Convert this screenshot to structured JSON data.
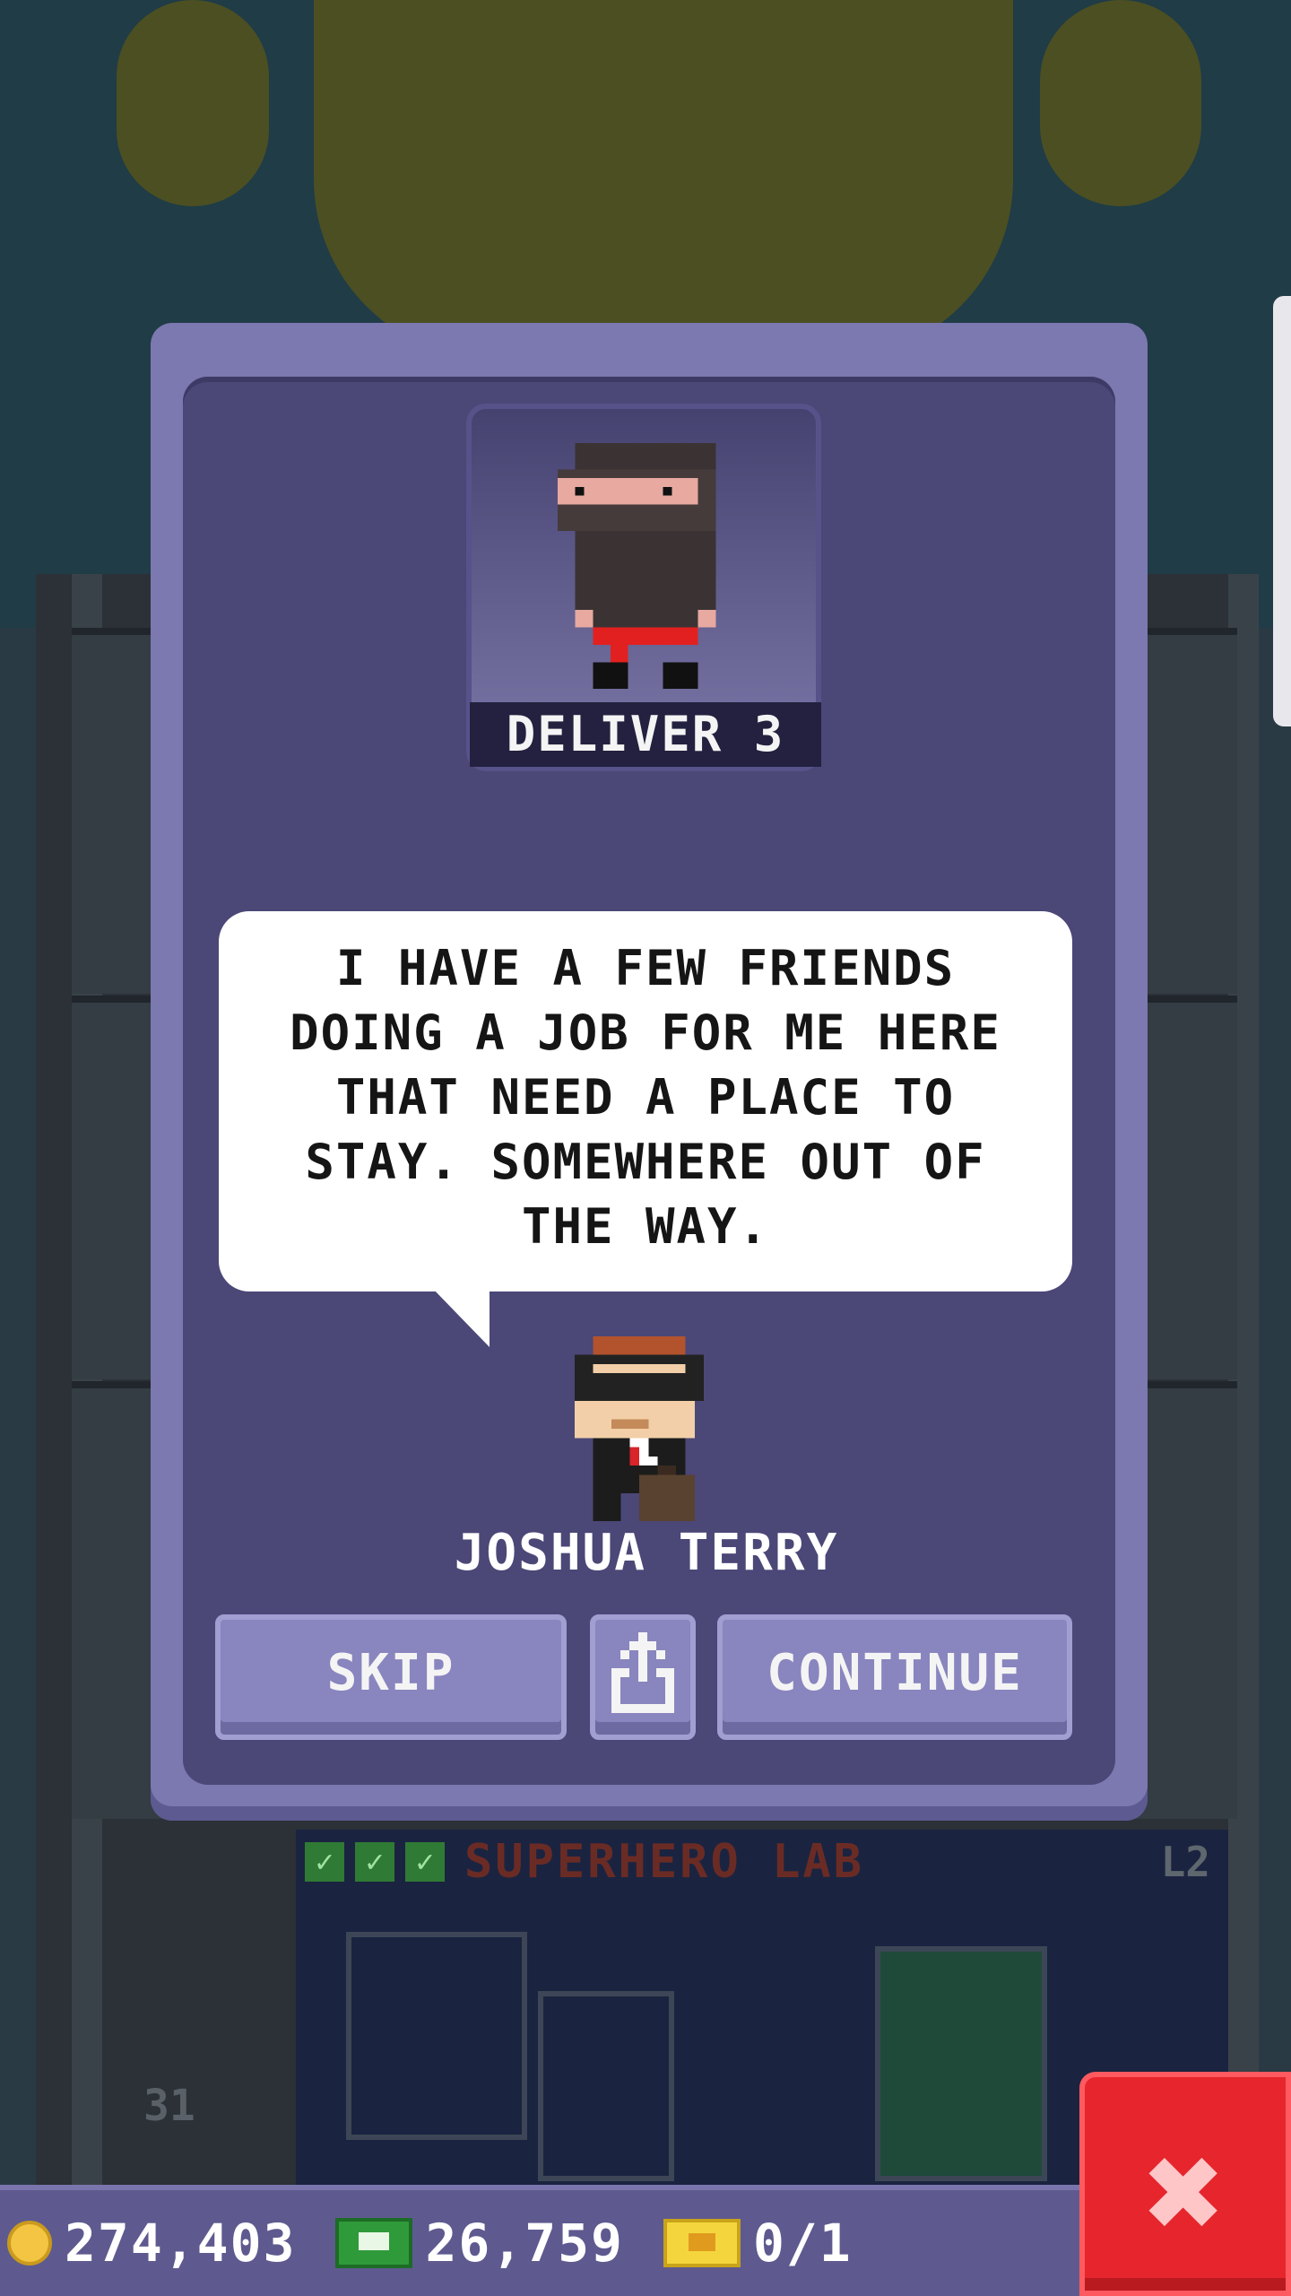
{
  "mission": {
    "portrait_label": "DELIVER 3",
    "portrait_icon": "ninja-character",
    "speech": [
      "I HAVE A FEW FRIENDS",
      "DOING A JOB FOR ME HERE",
      "THAT NEED A PLACE TO",
      "STAY. SOMEWHERE OUT OF",
      "THE WAY."
    ],
    "speaker_name": "JOSHUA TERRY",
    "speaker_icon": "businessman-character"
  },
  "buttons": {
    "skip": "SKIP",
    "share_icon": "share-icon",
    "continue": "CONTINUE"
  },
  "background": {
    "floor_name": "SUPERHERO LAB",
    "floor_level": "L2",
    "floor_number": "31"
  },
  "hud": {
    "coins": "274,403",
    "bux": "26,759",
    "tickets": "0/1"
  },
  "close_icon": "close-x-icon",
  "colors": {
    "dialog": "#7c78b0",
    "dialog_inner": "#4b4777",
    "close": "#e6262c",
    "coin": "#f4c542",
    "bux": "#2f9a3a",
    "ticket": "#f5d53d"
  }
}
